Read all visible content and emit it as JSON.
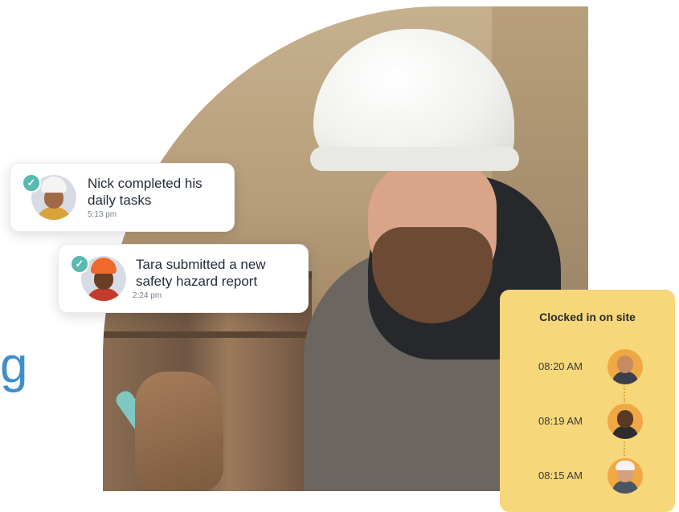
{
  "brand_partial_letter": "g",
  "notifications": [
    {
      "message": "Nick completed his daily tasks",
      "time": "5:13 pm",
      "avatar": "worker-white-helmet-avatar",
      "check_icon": "check-icon"
    },
    {
      "message": "Tara submitted a new safety hazard report",
      "time": "2:24 pm",
      "avatar": "worker-orange-helmet-avatar",
      "check_icon": "check-icon"
    }
  ],
  "clock_panel": {
    "title": "Clocked in on site",
    "entries": [
      {
        "time": "08:20 AM",
        "avatar": "bearded-man-avatar"
      },
      {
        "time": "08:19 AM",
        "avatar": "man-avatar"
      },
      {
        "time": "08:15 AM",
        "avatar": "worker-helmet-avatar"
      }
    ]
  },
  "colors": {
    "accent_blue": "#3e8ed0",
    "check_teal": "#57b9b0",
    "panel_yellow": "#f6d77a",
    "text_dark": "#1f2a3d"
  }
}
